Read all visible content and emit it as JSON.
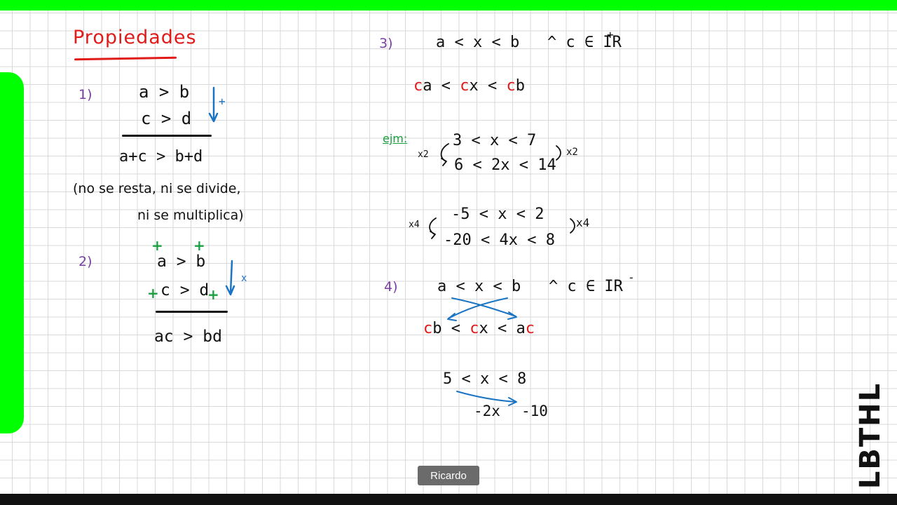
{
  "title": "Propiedades",
  "brand": "LBTHL",
  "participant": "Ricardo",
  "colors": {
    "frame_green": "#00ff00",
    "ink_red": "#e11a1a",
    "ink_blue": "#1a74c4",
    "ink_green": "#18a040",
    "ink_purple": "#7a3fa3",
    "bottom_bar": "#111111"
  },
  "props": {
    "p1": {
      "num": "1)",
      "line1": "a > b",
      "line2": "c > d",
      "result": "a+c > b+d",
      "arrow_mark": "+",
      "note1": "(no se resta, ni se divide,",
      "note2": "ni se multiplica)"
    },
    "p2": {
      "num": "2)",
      "line1": "a > b",
      "line2": "c > d",
      "result": "ac > bd",
      "arrow_mark": "x",
      "plus": "+"
    },
    "p3": {
      "num": "3)",
      "condition": "a < x < b   ^ c ∈ IR",
      "sup": "+",
      "res": {
        "c1": "c",
        "t1": "a < ",
        "c2": "c",
        "t2": "x < ",
        "c3": "c",
        "t3": "b"
      },
      "ejm": "ejm:",
      "ex1": {
        "left": "x2",
        "top": "3 < x < 7",
        "bottom": "6 < 2x < 14",
        "right": "x2"
      },
      "ex2": {
        "left": "x4",
        "top": "-5 < x < 2",
        "bottom": "-20 < 4x < 8",
        "right": "x4"
      }
    },
    "p4": {
      "num": "4)",
      "condition": "a < x < b   ^ c ∈ IR",
      "sup": "-",
      "res": {
        "c1": "c",
        "t1": "b < ",
        "c2": "c",
        "t2": "x < a",
        "c3": "c"
      },
      "ex_top": "5 < x < 8",
      "ex_left": "-2x",
      "ex_right": "-10"
    }
  }
}
